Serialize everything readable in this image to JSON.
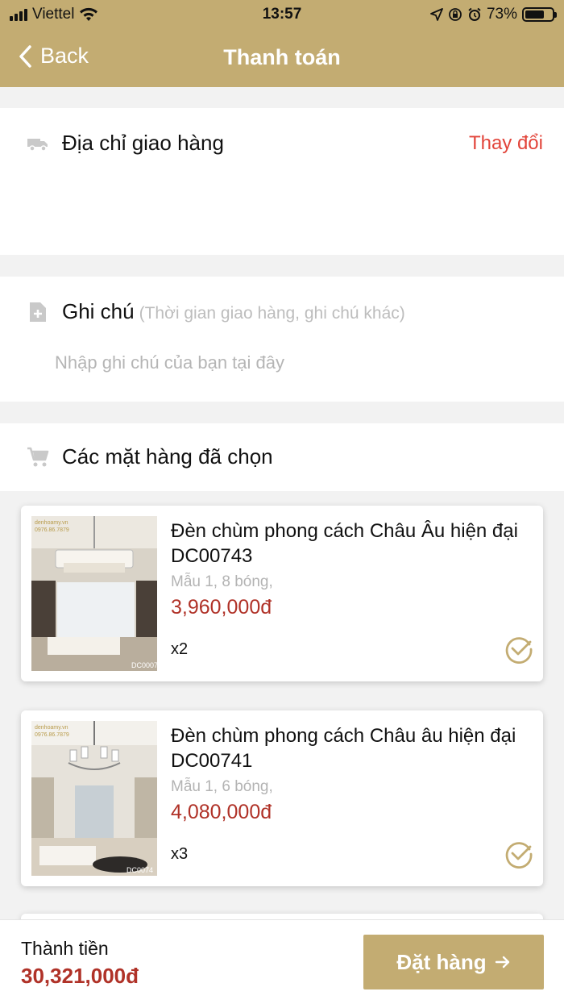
{
  "status_bar": {
    "carrier": "Viettel",
    "time": "13:57",
    "battery": "73%",
    "battery_level": 0.73
  },
  "header": {
    "back_label": "Back",
    "title": "Thanh toán"
  },
  "address": {
    "title": "Địa chỉ giao hàng",
    "change_label": "Thay đổi"
  },
  "note": {
    "title": "Ghi chú",
    "hint": "(Thời gian giao hàng, ghi chú khác)",
    "placeholder": "Nhập ghi chú của bạn tại đây"
  },
  "items_section": {
    "title": "Các mặt hàng đã chọn"
  },
  "products": [
    {
      "name": "Đèn chùm phong cách Châu Âu hiện đại DC00743",
      "variant": "Mẫu 1, 8 bóng,",
      "price": "3,960,000đ",
      "qty": "x2",
      "thumb_watermark": "denhoamy.vn",
      "thumb_phone": "0976.86.7879",
      "thumb_code": "DC0007"
    },
    {
      "name": "Đèn chùm phong cách Châu âu hiện đại DC00741",
      "variant": "Mẫu 1, 6 bóng,",
      "price": "4,080,000đ",
      "qty": "x3",
      "thumb_watermark": "denhoamy.vn",
      "thumb_phone": "0976.86.7879",
      "thumb_code": "DC0074"
    }
  ],
  "footer": {
    "total_label": "Thành tiền",
    "total_value": "30,321,000đ",
    "order_label": "Đặt hàng"
  },
  "colors": {
    "brand": "#c3ac72",
    "price": "#b03228",
    "change": "#e2443a",
    "background": "#f2f2f2"
  },
  "icons": {
    "back": "chevron-left-icon",
    "truck": "truck-icon",
    "note": "note-add-icon",
    "cart": "cart-icon",
    "check": "check-circle-icon",
    "arrow": "arrow-right-icon"
  }
}
